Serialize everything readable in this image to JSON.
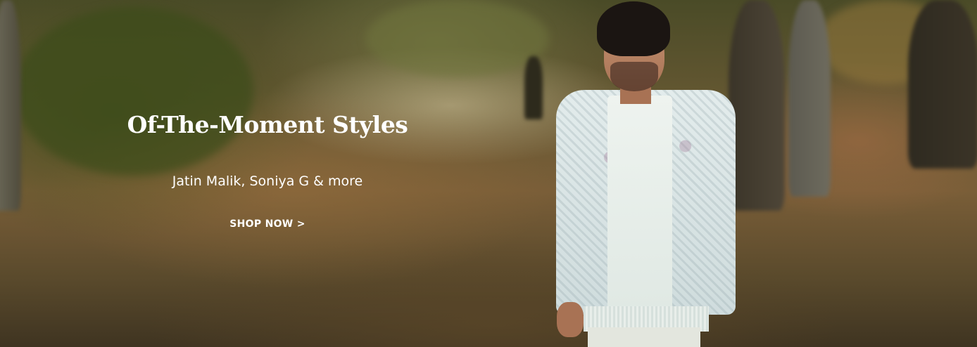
{
  "banner": {
    "headline": "Of-The-Moment Styles",
    "subline": "Jatin Malik, Soniya G & more",
    "cta_label": "SHOP NOW >",
    "text_color": "#ffffff"
  }
}
